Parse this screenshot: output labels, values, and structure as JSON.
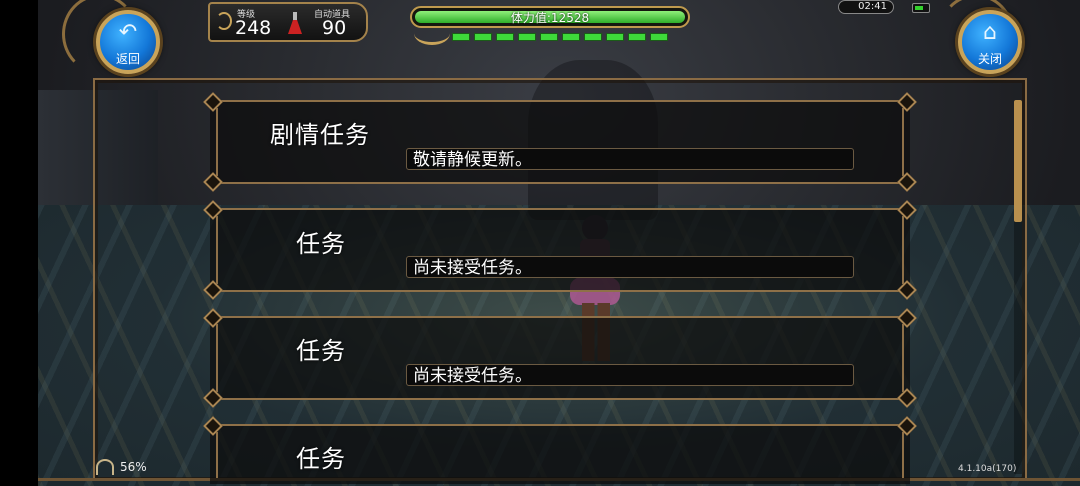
{
  "hud": {
    "back_label": "返回",
    "close_label": "关闭",
    "level_label": "等级",
    "level_value": "248",
    "auto_item_label": "自动道具",
    "auto_item_value": "90",
    "stamina_text": "体力值:12528",
    "stamina_fill": 1.0,
    "time": "02:41",
    "battery_level": 0.6
  },
  "quests": [
    {
      "title": "剧情任务",
      "status": "敬请静候更新。"
    },
    {
      "title": "任务",
      "status": "尚未接受任务。"
    },
    {
      "title": "任务",
      "status": "尚未接受任务。"
    },
    {
      "title": "任务",
      "status": ""
    }
  ],
  "footer": {
    "percent": "56%",
    "version": "4.1.10a(170)"
  },
  "colors": {
    "frame_gold": "#a98552",
    "stamina_green": "#3ed93a",
    "button_blue": "#1377d8"
  },
  "icons": {
    "back": "back-arrow-icon",
    "close": "home-icon",
    "level": "level-icon",
    "auto_item": "potion-icon",
    "clock": "clock-icon",
    "battery": "battery-icon",
    "signal": "signal-icon"
  }
}
